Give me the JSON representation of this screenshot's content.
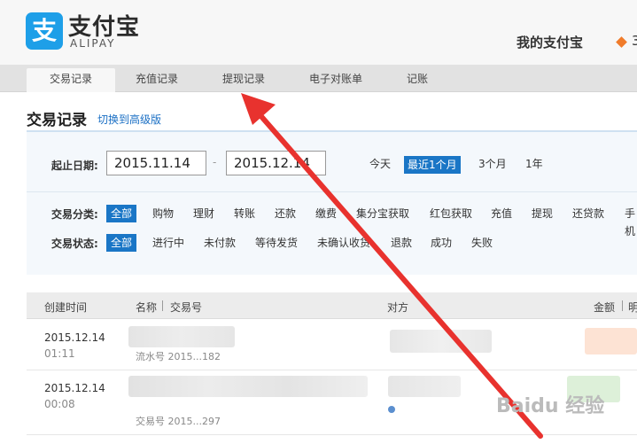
{
  "header": {
    "logo_glyph": "支",
    "logo_cn": "支付宝",
    "logo_en": "ALIPAY",
    "my_alipay": "我的支付宝",
    "cut_text": "3"
  },
  "nav": [
    "交易记录",
    "充值记录",
    "提现记录",
    "电子对账单",
    "记账"
  ],
  "page": {
    "title": "交易记录",
    "switch_link": "切换到高级版"
  },
  "filters": {
    "date_label": "起止日期:",
    "start_date": "2015.11.14",
    "end_date": "2015.12.14",
    "date_dash": "-",
    "quick_ranges": [
      "今天",
      "最近1个月",
      "3个月",
      "1年"
    ],
    "category_label": "交易分类:",
    "categories": [
      "全部",
      "购物",
      "理财",
      "转账",
      "还款",
      "缴费",
      "集分宝获取",
      "红包获取",
      "充值",
      "提现",
      "还贷款",
      "手机"
    ],
    "status_label": "交易状态:",
    "statuses": [
      "全部",
      "进行中",
      "未付款",
      "等待发货",
      "未确认收货",
      "退款",
      "成功",
      "失败"
    ]
  },
  "table": {
    "headers": {
      "created": "创建时间",
      "name": "名称",
      "trade_no": "交易号",
      "counterparty": "对方",
      "amount": "金额",
      "detail": "明"
    },
    "rows": [
      {
        "date": "2015.12.14",
        "time": "01:11",
        "sub": "流水号 2015...182"
      },
      {
        "date": "2015.12.14",
        "time": "00:08",
        "sub": "交易号 2015...297"
      }
    ]
  },
  "watermark": "Baidu 经验",
  "colors": {
    "accent": "#1a76c6",
    "arrow": "#e8322e",
    "brand": "#1e9fe8"
  }
}
